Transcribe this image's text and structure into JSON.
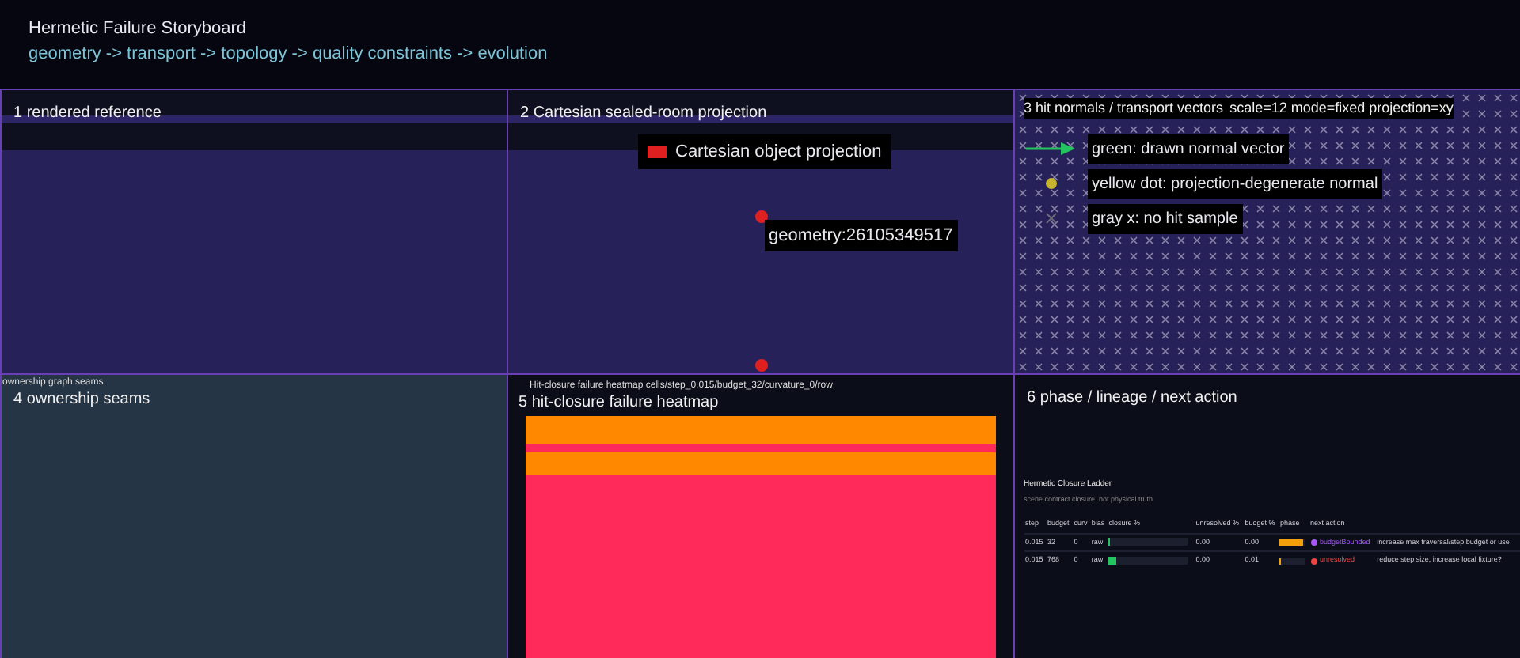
{
  "header": {
    "title": "Hermetic Failure Storyboard",
    "pipeline": "geometry -> transport -> topology -> quality constraints -> evolution"
  },
  "panels": [
    {
      "kind": "reference",
      "title": "1 rendered reference"
    },
    {
      "kind": "projection",
      "title": "2 Cartesian sealed-room projection",
      "legend": [
        {
          "label": "Cartesian object projection",
          "color": "#e02020"
        }
      ],
      "point_label": "geometry:26105349517"
    },
    {
      "kind": "normals",
      "title": "3 hit normals / transport vectors",
      "caption": "scale=12 mode=fixed projection=xy",
      "legend": [
        {
          "kind": "arrow",
          "color": "#22c55e",
          "label": "green: drawn normal vector"
        },
        {
          "kind": "dot",
          "color": "#c8b42a",
          "label": "yellow dot: projection-degenerate normal"
        },
        {
          "kind": "cross",
          "color": "#6b6b7a",
          "label": "gray x: no hit sample"
        }
      ]
    },
    {
      "kind": "seams",
      "title": "4 ownership seams",
      "caption": "ownership graph seams"
    },
    {
      "kind": "heatmap",
      "title": "5 hit-closure failure heatmap",
      "caption": "Hit-closure failure heatmap cells/step_0.015/budget_32/curvature_0/row",
      "rows": [
        {
          "color": "#ff8800"
        },
        {
          "color": "#ff2a5a"
        },
        {
          "color": "#ff8800"
        },
        {
          "color": "#ff2a5a"
        }
      ]
    },
    {
      "kind": "ladder",
      "title": "6 phase / lineage / next action",
      "table_title": "Hermetic Closure Ladder",
      "table_subtitle": "scene contract closure, not physical truth",
      "columns": [
        "step",
        "budget",
        "curv",
        "bias",
        "closure %",
        "unresolved %",
        "budget %",
        "phase",
        "next action"
      ],
      "rows": [
        {
          "step": "0.015",
          "budget": "32",
          "curv": "0",
          "bias": "raw",
          "closure_bar": {
            "level": 0.02
          },
          "unresolved": "0.00",
          "budget_pct": "0.00",
          "budget_bar": {
            "level": 0.9
          },
          "phase": {
            "label": "budgetBounded",
            "color": "#a855f7"
          },
          "action": "increase max traversal/step budget or use"
        },
        {
          "step": "0.015",
          "budget": "768",
          "curv": "0",
          "bias": "raw",
          "closure_bar": {
            "level": 0.1
          },
          "unresolved": "0.00",
          "budget_pct": "0.01",
          "budget_bar": {
            "level": 0.05
          },
          "phase": {
            "label": "unresolved",
            "color": "#ef4444"
          },
          "action": "reduce step size, increase local fixture?"
        }
      ]
    }
  ]
}
